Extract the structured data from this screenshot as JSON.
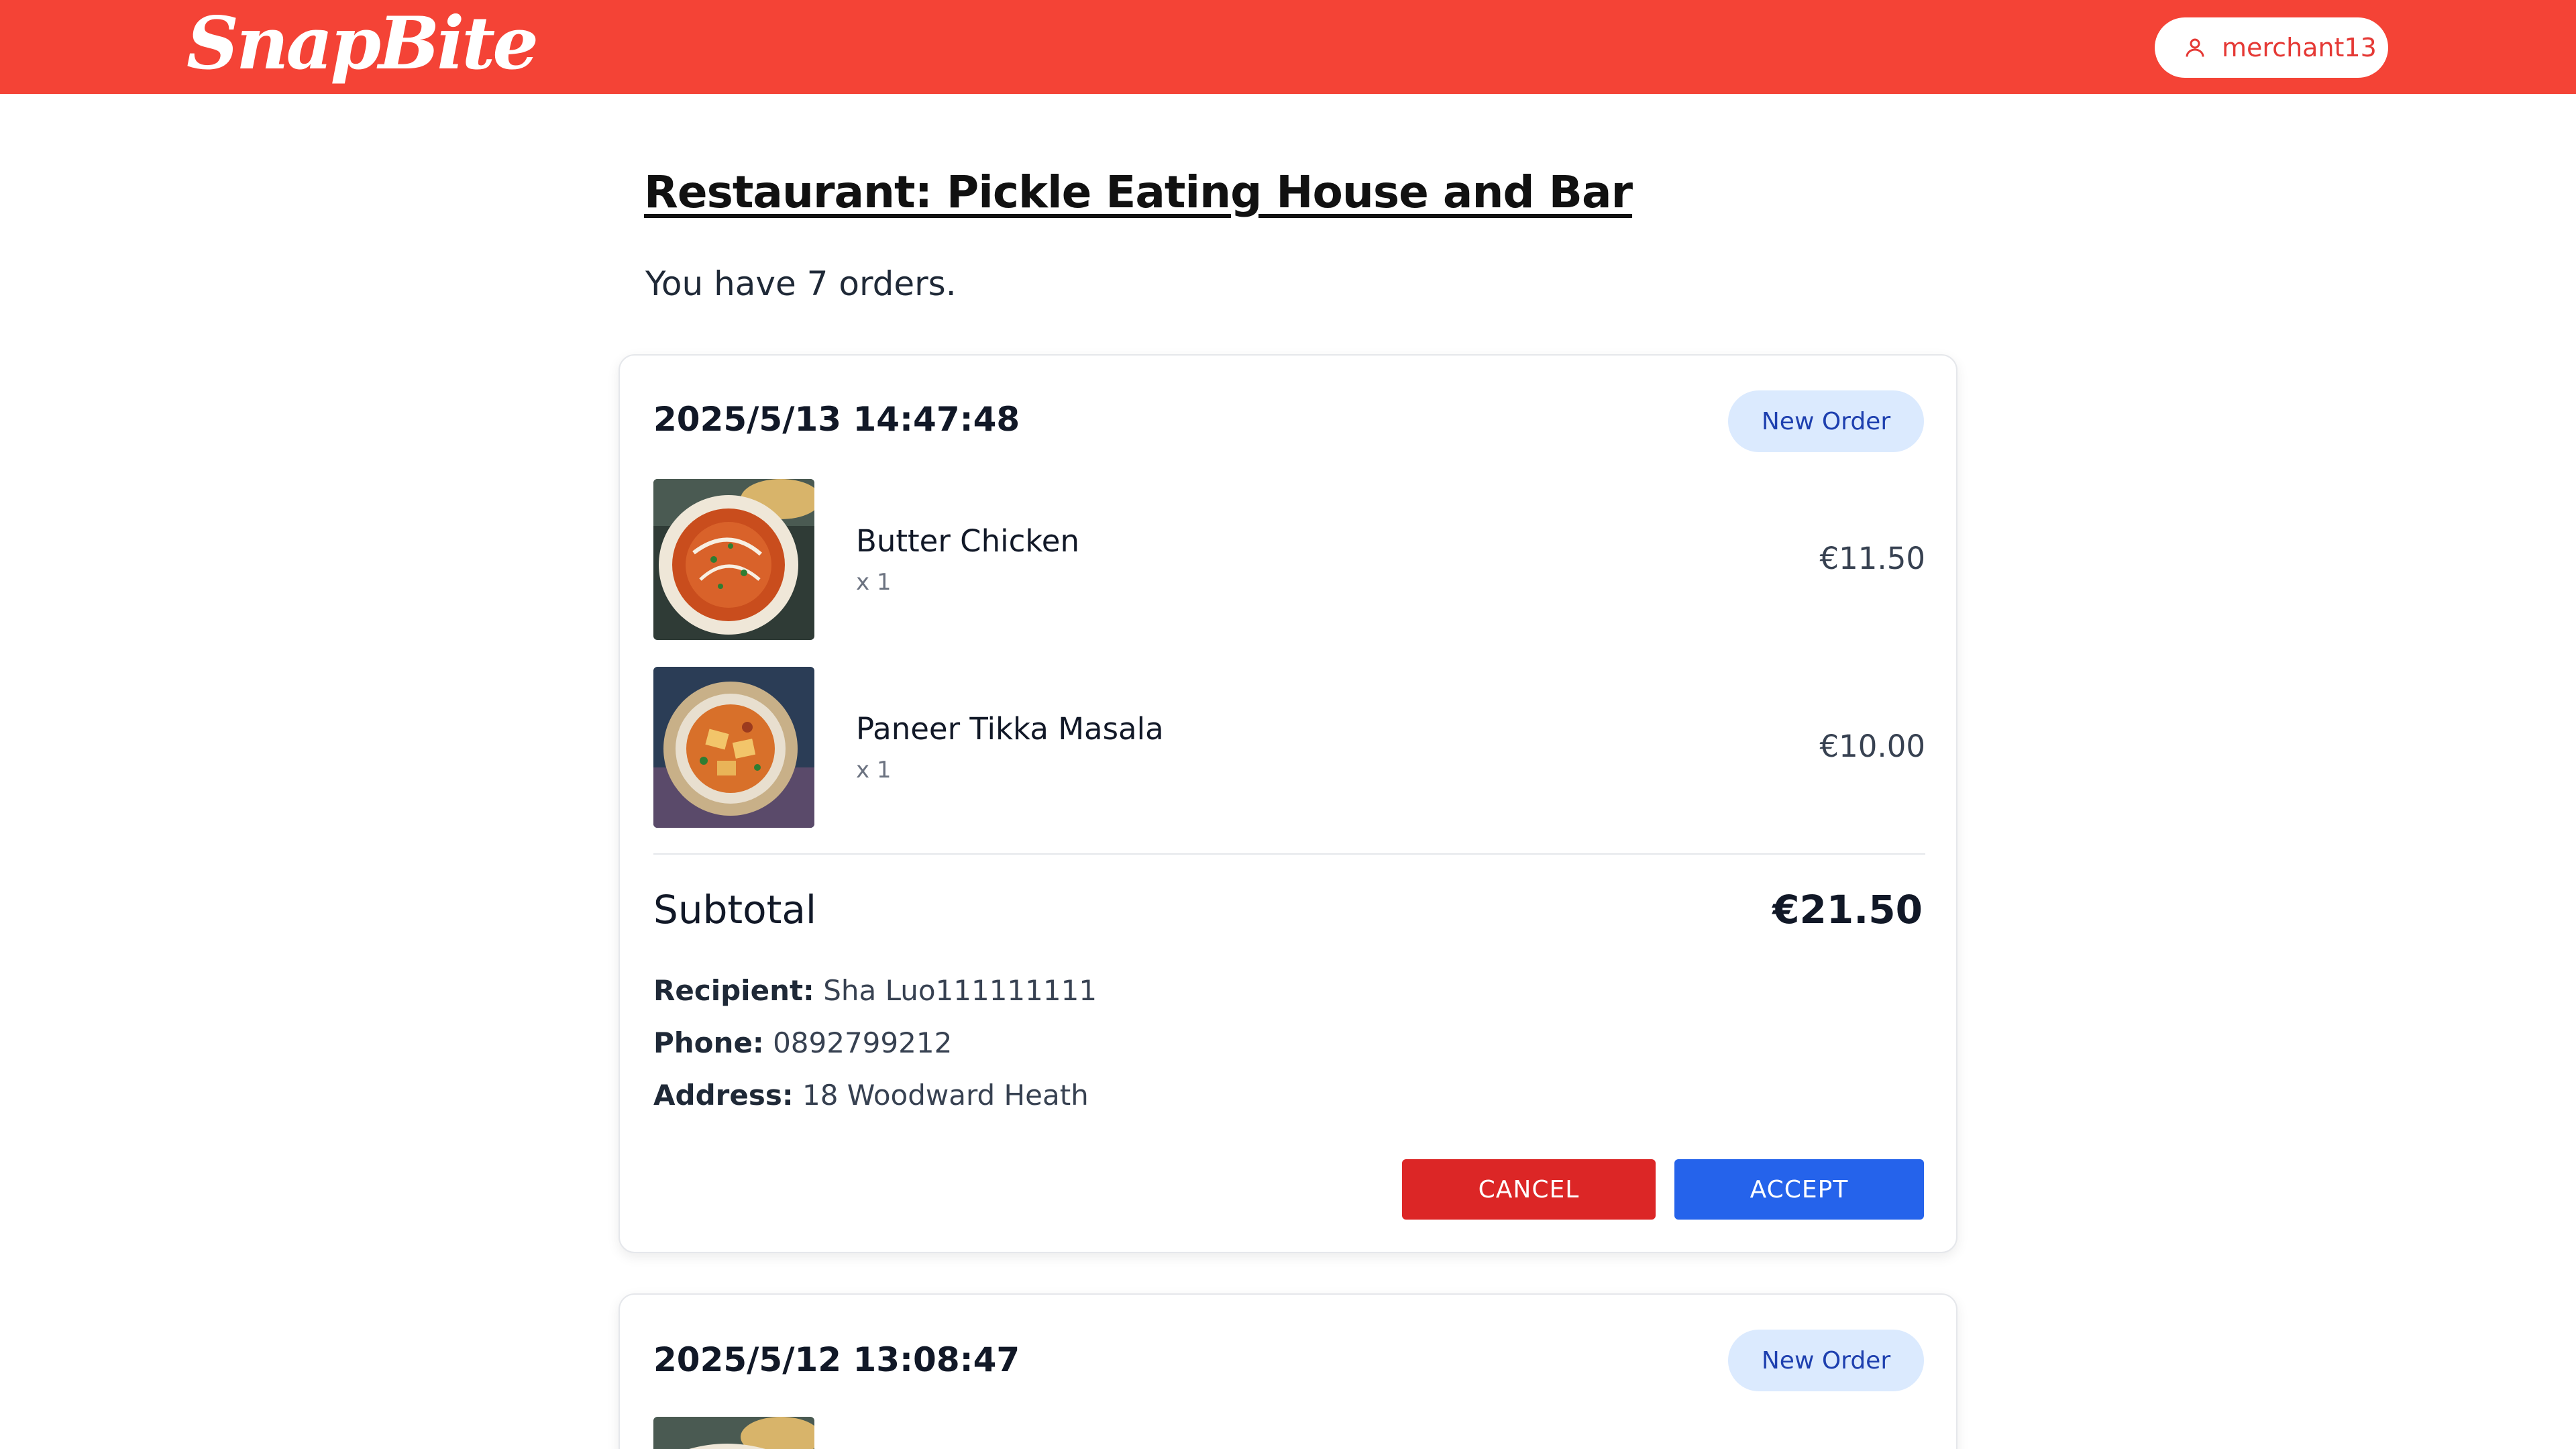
{
  "header": {
    "logo_text": "SnapBite",
    "user_label": "merchant13",
    "brand_color": "#f44336"
  },
  "main": {
    "title": "Restaurant: Pickle Eating House and Bar",
    "order_count_text": "You have 7 orders."
  },
  "orders": [
    {
      "timestamp": "2025/5/13 14:47:48",
      "status": "New Order",
      "items": [
        {
          "name": "Butter Chicken",
          "qty": "x 1",
          "price": "€11.50",
          "image": "butter-chicken-image"
        },
        {
          "name": "Paneer Tikka Masala",
          "qty": "x 1",
          "price": "€10.00",
          "image": "paneer-tikka-masala-image"
        }
      ],
      "subtotal_label": "Subtotal",
      "subtotal_value": "€21.50",
      "recipient_label": "Recipient:",
      "recipient_value": "Sha Luo111111111",
      "phone_label": "Phone:",
      "phone_value": "0892799212",
      "address_label": "Address:",
      "address_value": "18 Woodward Heath",
      "cancel_label": "CANCEL",
      "accept_label": "ACCEPT"
    },
    {
      "timestamp": "2025/5/12 13:08:47",
      "status": "New Order"
    }
  ],
  "colors": {
    "cancel": "#dc2626",
    "accept": "#2563eb",
    "badge_bg": "#dbeafe",
    "badge_text": "#1e40af"
  }
}
